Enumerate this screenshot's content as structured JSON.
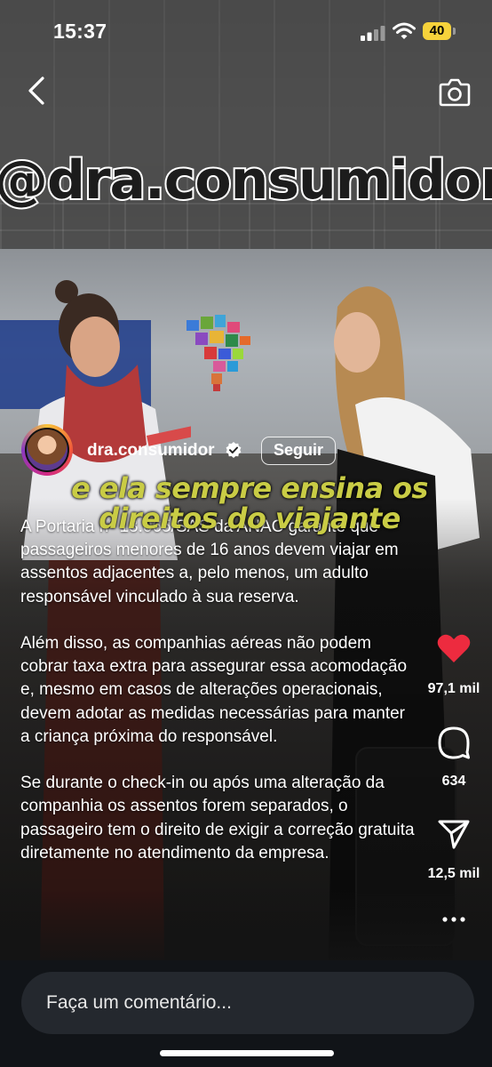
{
  "status_bar": {
    "time": "15:37",
    "battery": "40"
  },
  "video_overlay": {
    "handle_text": "@dra.consumidor",
    "caption": "e ela sempre ensina os direitos do viajante"
  },
  "author": {
    "username": "dra.consumidor",
    "follow_label": "Seguir"
  },
  "description": {
    "paragraphs": [
      "A Portaria nº 13.065/SAS da ANAC garante que passageiros menores de 16 anos devem viajar em assentos adjacentes a, pelo menos, um adulto responsável vinculado à sua reserva.",
      "Além disso, as companhias aéreas não podem cobrar taxa extra para assegurar essa acomodação e, mesmo em casos de alterações operacionais, devem adotar as medidas necessárias para manter a criança próxima do responsável.",
      "Se durante o check-in ou após uma alteração da companhia os assentos forem separados, o passageiro tem o direito de exigir a correção gratuita diretamente no atendimento da empresa."
    ]
  },
  "actions": {
    "likes": "97,1 mil",
    "comments": "634",
    "shares": "12,5 mil"
  },
  "comment_bar": {
    "placeholder": "Faça um comentário..."
  },
  "colors": {
    "like": "#ed2b3f",
    "caption": "#c9cc45",
    "battery": "#f7d33b",
    "bottom_bar": "#111418"
  },
  "icons": [
    "back-icon",
    "camera-icon",
    "verified-icon",
    "heart-icon",
    "comment-icon",
    "share-icon",
    "more-icon",
    "signal-icon",
    "wifi-icon",
    "battery-icon"
  ]
}
